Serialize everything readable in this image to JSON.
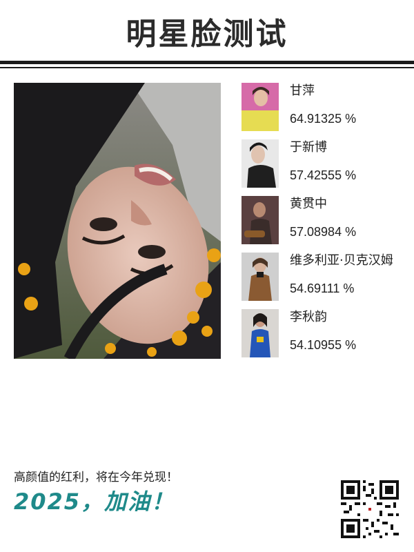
{
  "header": {
    "title": "明星脸测试"
  },
  "photo": {
    "description_icon": "user-photo"
  },
  "matches": [
    {
      "name": "甘萍",
      "score": "64.91325 %"
    },
    {
      "name": "于新博",
      "score": "57.42555 %"
    },
    {
      "name": "黄贯中",
      "score": "57.08984 %"
    },
    {
      "name": "维多利亚·贝克汉姆",
      "score": "54.69111 %"
    },
    {
      "name": "李秋韵",
      "score": "54.10955 %"
    }
  ],
  "footer": {
    "tagline": "高颜值的红利，将在今年兑现！",
    "slogan": "2025，加油！"
  },
  "colors": {
    "accent": "#1f8a8a",
    "title": "#2b2b2b"
  }
}
